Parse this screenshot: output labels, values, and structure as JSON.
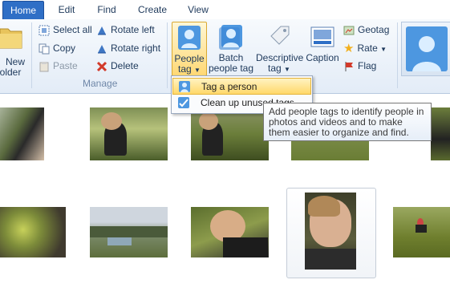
{
  "tabs": [
    {
      "label": "Home"
    },
    {
      "label": "Edit"
    },
    {
      "label": "Find"
    },
    {
      "label": "Create"
    },
    {
      "label": "View"
    }
  ],
  "new_folder": {
    "line1": "New",
    "line2": "older"
  },
  "manage": {
    "select_all": "Select all",
    "copy": "Copy",
    "paste": "Paste",
    "rotate_left": "Rotate left",
    "rotate_right": "Rotate right",
    "delete": "Delete",
    "group_label": "Manage"
  },
  "tagging": {
    "people_tag_line1": "People",
    "people_tag_line2": "tag",
    "batch_line1": "Batch",
    "batch_line2": "people tag",
    "descriptive_line1": "Descriptive",
    "descriptive_line2": "tag",
    "caption": "Caption",
    "geotag": "Geotag",
    "rate": "Rate",
    "flag": "Flag"
  },
  "menu": {
    "tag_person": "Tag a person",
    "clean_up": "Clean up unused tags"
  },
  "tooltip": {
    "text": "Add people tags to identify people in photos and videos and to make them easier to organize and find."
  },
  "colors": {
    "accent": "#2f6fc6",
    "highlight": "#ffd86a",
    "delete_red": "#d23a2a"
  }
}
